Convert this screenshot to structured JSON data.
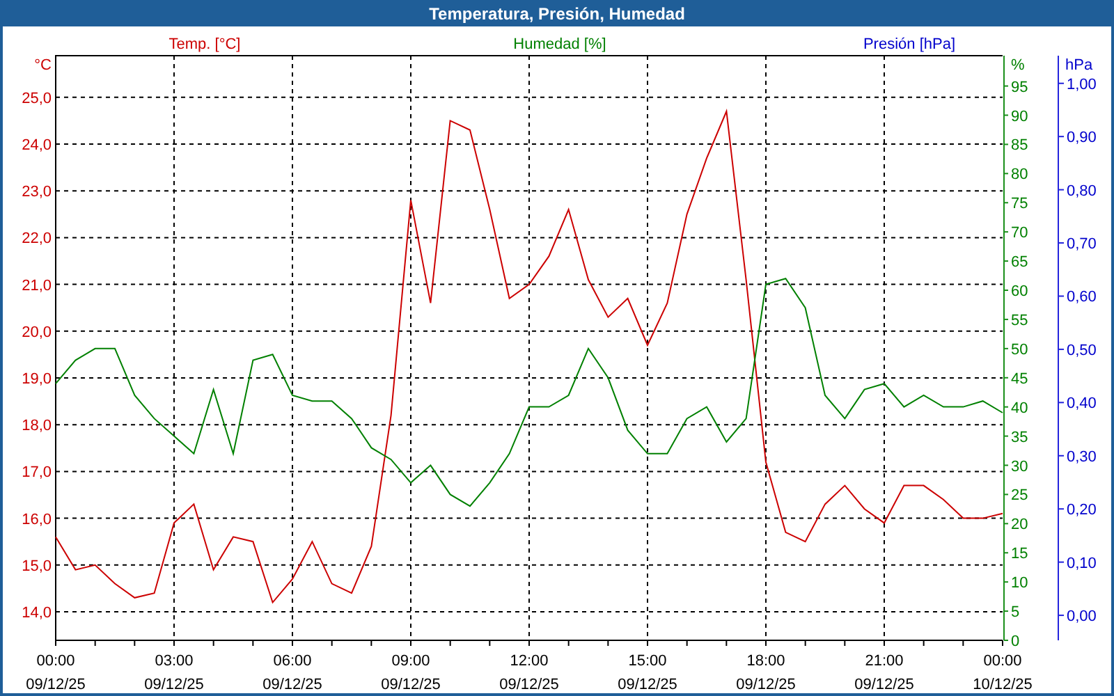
{
  "window": {
    "title": "Temperatura, Presión, Humedad"
  },
  "chart_data": {
    "type": "line",
    "ylabel": "°C",
    "y2label": "%",
    "y3label": "hPa",
    "categories": [
      "00:00\n09/12/25",
      null,
      null,
      null,
      null,
      null,
      "03:00\n09/12/25",
      null,
      null,
      null,
      null,
      null,
      "06:00\n09/12/25",
      null,
      null,
      null,
      null,
      null,
      "09:00\n09/12/25",
      null,
      null,
      null,
      null,
      null,
      "12:00\n09/12/25",
      null,
      null,
      null,
      null,
      null,
      "15:00\n09/12/25",
      null,
      null,
      null,
      null,
      null,
      "18:00\n09/12/25",
      null,
      null,
      null,
      null,
      null,
      "21:00\n09/12/25",
      null,
      null,
      null,
      null,
      null,
      "00:00\n10/12/25"
    ],
    "grid": true,
    "ylim": [
      13.39,
      25.89
    ],
    "y2lim": [
      0,
      100.2
    ],
    "y3lim": [
      -0.047,
      1.052
    ],
    "yticks": [
      {
        "value": 14,
        "label": "14,0"
      },
      {
        "value": 15,
        "label": "15,0"
      },
      {
        "value": 16,
        "label": "16,0"
      },
      {
        "value": 17,
        "label": "17,0"
      },
      {
        "value": 18,
        "label": "18,0"
      },
      {
        "value": 19,
        "label": "19,0"
      },
      {
        "value": 20,
        "label": "20,0"
      },
      {
        "value": 21,
        "label": "21,0"
      },
      {
        "value": 22,
        "label": "22,0"
      },
      {
        "value": 23,
        "label": "23,0"
      },
      {
        "value": 24,
        "label": "24,0"
      },
      {
        "value": 25,
        "label": "25,0"
      }
    ],
    "y2ticks": [
      0,
      5,
      10,
      15,
      20,
      25,
      30,
      35,
      40,
      45,
      50,
      55,
      60,
      65,
      70,
      75,
      80,
      85,
      90,
      95
    ],
    "y3ticks": [
      {
        "value": 0,
        "label": "0,00"
      },
      {
        "value": 0.1,
        "label": "0,10"
      },
      {
        "value": 0.2,
        "label": "0,20"
      },
      {
        "value": 0.3,
        "label": "0,30"
      },
      {
        "value": 0.4,
        "label": "0,40"
      },
      {
        "value": 0.5,
        "label": "0,50"
      },
      {
        "value": 0.6,
        "label": "0,60"
      },
      {
        "value": 0.7,
        "label": "0,70"
      },
      {
        "value": 0.8,
        "label": "0,80"
      },
      {
        "value": 0.9,
        "label": "0,90"
      },
      {
        "value": 1,
        "label": "1,00"
      }
    ],
    "series": [
      {
        "name": "Temp. [°C]",
        "color": "#cc0000",
        "axis": "y",
        "values": [
          15.6,
          14.9,
          15.0,
          14.6,
          14.3,
          14.4,
          15.9,
          16.3,
          14.9,
          15.6,
          15.5,
          14.2,
          14.7,
          15.5,
          14.6,
          14.4,
          15.4,
          18.2,
          22.8,
          20.6,
          24.5,
          24.3,
          22.6,
          20.7,
          21.0,
          21.6,
          22.6,
          21.1,
          20.3,
          20.7,
          19.7,
          20.6,
          22.5,
          23.7,
          24.7,
          21.1,
          17.2,
          15.7,
          15.5,
          16.3,
          16.7,
          16.2,
          15.9,
          16.7,
          16.7,
          16.4,
          16.0,
          16.0,
          16.1
        ]
      },
      {
        "name": "Humedad [%]",
        "color": "#008000",
        "axis": "y2",
        "values": [
          44,
          48,
          50,
          50,
          42,
          38,
          35,
          32,
          43,
          32,
          48,
          49,
          42,
          41,
          41,
          38,
          33,
          31,
          27,
          30,
          25,
          23,
          27,
          32,
          40,
          40,
          42,
          50,
          45,
          36,
          32,
          32,
          38,
          40,
          34,
          38,
          61,
          62,
          57,
          42,
          38,
          43,
          44,
          40,
          42,
          40,
          40,
          41,
          39
        ]
      },
      {
        "name": "Presión [hPa]",
        "color": "#0000cc",
        "axis": "y3",
        "values": [
          null,
          null,
          null,
          null,
          null,
          null,
          null,
          null,
          null,
          null,
          null,
          null,
          null,
          null,
          null,
          null,
          null,
          null,
          null,
          null,
          null,
          null,
          null,
          null,
          null,
          null,
          null,
          null,
          null,
          null,
          null,
          null,
          null,
          null,
          null,
          null,
          null,
          null,
          null,
          null,
          null,
          null,
          null,
          null,
          null,
          null,
          null,
          null,
          null
        ]
      }
    ]
  }
}
